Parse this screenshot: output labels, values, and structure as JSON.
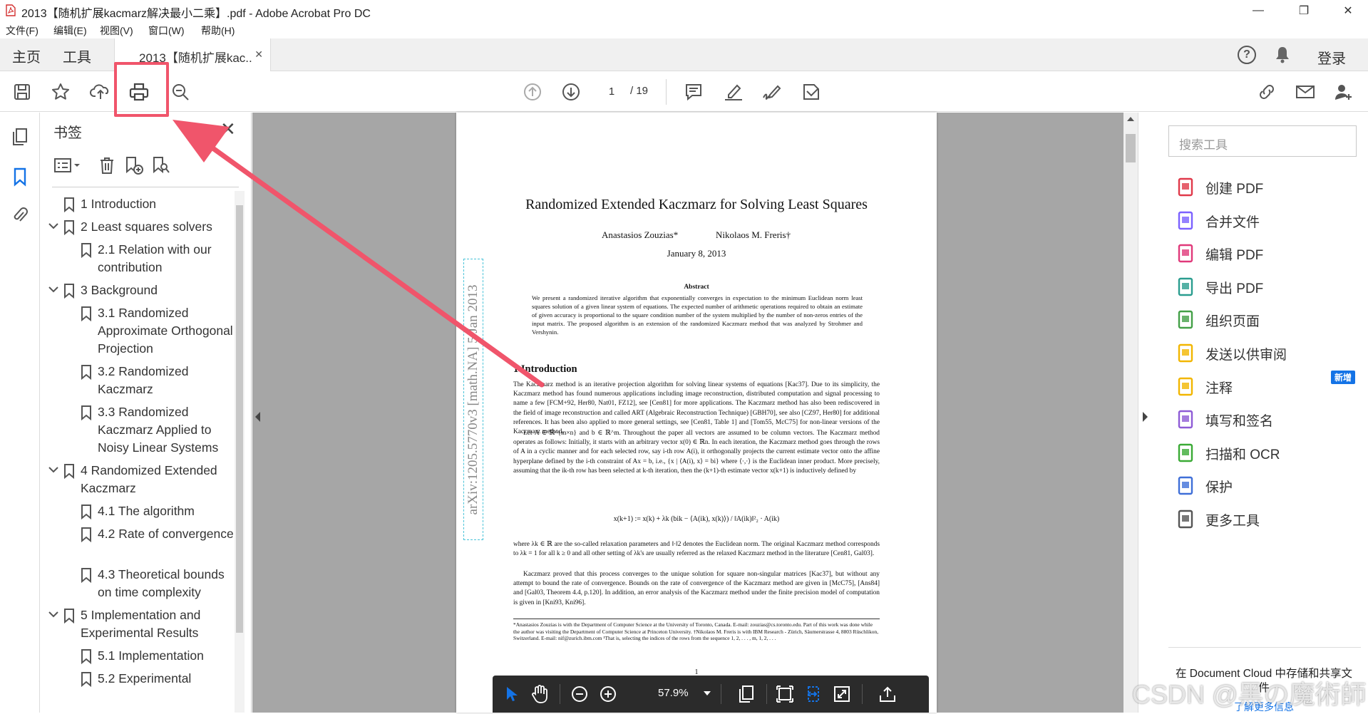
{
  "window": {
    "title": "2013【随机扩展kacmarz解决最小二乘】.pdf - Adobe Acrobat Pro DC",
    "minimize": "—",
    "maximize": "❐",
    "close": "✕"
  },
  "menu": [
    "文件(F)",
    "编辑(E)",
    "视图(V)",
    "窗口(W)",
    "帮助(H)"
  ],
  "tabs": {
    "home": "主页",
    "tools": "工具",
    "document": "2013【随机扩展kac...",
    "close": "✕",
    "help": "?",
    "login": "登录"
  },
  "toolbar": {
    "page_current": "1",
    "page_total": "/ 19",
    "icons": [
      "save-icon",
      "star-icon",
      "upload-icon",
      "print-icon",
      "zoom-search-icon",
      "page-up-icon",
      "page-down-icon",
      "comment-icon",
      "highlight-icon",
      "sign-icon",
      "stamp-icon",
      "share-link-icon",
      "email-icon",
      "add-user-icon"
    ]
  },
  "bookmarks": {
    "title": "书签",
    "close": "✕",
    "items": [
      {
        "label": "1 Introduction",
        "level": 0,
        "expandable": false
      },
      {
        "label": "2 Least squares solvers",
        "level": 0,
        "expandable": true
      },
      {
        "label": "2.1 Relation with our contribution",
        "level": 1,
        "expandable": false
      },
      {
        "label": "3 Background",
        "level": 0,
        "expandable": true
      },
      {
        "label": "3.1 Randomized Approximate Orthogonal Projection",
        "level": 1,
        "expandable": false
      },
      {
        "label": "3.2 Randomized Kaczmarz",
        "level": 1,
        "expandable": false
      },
      {
        "label": "3.3 Randomized Kaczmarz Applied to Noisy Linear Systems",
        "level": 1,
        "expandable": false
      },
      {
        "label": "4 Randomized Extended Kaczmarz",
        "level": 0,
        "expandable": true
      },
      {
        "label": "4.1 The algorithm",
        "level": 1,
        "expandable": false
      },
      {
        "label": "4.2 Rate of convergence",
        "level": 1,
        "expandable": false
      },
      {
        "label": "4.3 Theoretical bounds on time complexity",
        "level": 1,
        "expandable": false
      },
      {
        "label": "5 Implementation and Experimental Results",
        "level": 0,
        "expandable": true
      },
      {
        "label": "5.1 Implementation",
        "level": 1,
        "expandable": false
      },
      {
        "label": "5.2 Experimental",
        "level": 1,
        "expandable": false
      }
    ]
  },
  "pdf": {
    "arxiv": "arXiv:1205.5770v3  [math.NA]  5 Jan 2013",
    "title": "Randomized Extended Kaczmarz for Solving Least Squares",
    "author1": "Anastasios Zouzias*",
    "author2": "Nikolaos M. Freris†",
    "date": "January 8, 2013",
    "abstract_head": "Abstract",
    "abstract": "We present a randomized iterative algorithm that exponentially converges in expectation to the minimum Euclidean norm least squares solution of a given linear system of equations. The expected number of arithmetic operations required to obtain an estimate of given accuracy is proportional to the square condition number of the system multiplied by the number of non-zeros entries of the input matrix. The proposed algorithm is an extension of the randomized Kaczmarz method that was analyzed by Strohmer and Vershynin.",
    "section": "1   Introduction",
    "para1": "The Kaczmarz method is an iterative projection algorithm for solving linear systems of equations [Kac37]. Due to its simplicity, the Kaczmarz method has found numerous applications including image reconstruction, distributed computation and signal processing to name a few [FCM+92, Her80, Nat01, FZ12], see [Cen81] for more applications. The Kaczmarz method has also been rediscovered in the field of image reconstruction and called ART (Algebraic Reconstruction Technique) [GBH70], see also [CZ97, Her80] for additional references. It has been also applied to more general settings, see [Cen81, Table 1] and [Tom55, McC75] for non-linear versions of the Kaczmarz method.",
    "para2": "Let A ∈ ℝ^{m×n} and b ∈ ℝ^m. Throughout the paper all vectors are assumed to be column vectors. The Kaczmarz method operates as follows: Initially, it starts with an arbitrary vector x(0) ∈ ℝn. In each iteration, the Kaczmarz method goes through the rows of A in a cyclic manner and for each selected row, say i-th row A(i), it orthogonally projects the current estimate vector onto the affine hyperplane defined by the i-th constraint of Ax = b, i.e., {x | ⟨A(i), x⟩ = bi} where ⟨·,·⟩ is the Euclidean inner product. More precisely, assuming that the ik-th row has been selected at k-th iteration, then the (k+1)-th estimate vector x(k+1) is inductively defined by",
    "formula": "x(k+1) := x(k) + λk (bik − ⟨A(ik), x(k)⟩) / ‖A(ik)‖²₂ · A(ik)",
    "para3": "where λk ∈ ℝ are the so-called relaxation parameters and ‖·‖2 denotes the Euclidean norm. The original Kaczmarz method corresponds to λk = 1 for all k ≥ 0 and all other setting of λk's are usually referred as the relaxed Kaczmarz method in the literature [Cen81, Gal03].",
    "para4": "Kaczmarz proved that this process converges to the unique solution for square non-singular matrices [Kac37], but without any attempt to bound the rate of convergence. Bounds on the rate of convergence of the Kaczmarz method are given in [McC75], [Ans84] and [Gal03, Theorem 4.4, p.120]. In addition, an error analysis of the Kaczmarz method under the finite precision model of computation is given in [Kni93, Kni96].",
    "footnote": "*Anastasios Zouzias is with the Department of Computer Science at the University of Toronto, Canada. E-mail: zouzias@cs.toronto.edu. Part of this work was done while the author was visiting the Department of Computer Science at Princeton University. †Nikolaos M. Freris is with IBM Research - Zürich, Säumerstrasse 4, 8803 Rüschlikon, Switzerland. E-mail: nif@zurich.ibm.com ¹That is, selecting the indices of the rows from the sequence 1, 2, . . . , m, 1, 2, . . .",
    "page_number": "1"
  },
  "floatbar": {
    "zoom": "57.9%"
  },
  "rightpane": {
    "search_placeholder": "搜索工具",
    "tools": [
      {
        "label": "创建 PDF",
        "icon": "create-pdf-icon",
        "color": "#e0394a"
      },
      {
        "label": "合并文件",
        "icon": "combine-files-icon",
        "color": "#7b61ff"
      },
      {
        "label": "编辑 PDF",
        "icon": "edit-pdf-icon",
        "color": "#e0397a"
      },
      {
        "label": "导出 PDF",
        "icon": "export-pdf-icon",
        "color": "#2a9d8f"
      },
      {
        "label": "组织页面",
        "icon": "organize-pages-icon",
        "color": "#43a047"
      },
      {
        "label": "发送以供审阅",
        "icon": "send-review-icon",
        "color": "#f2b600"
      },
      {
        "label": "注释",
        "icon": "comment-tool-icon",
        "color": "#f2b600"
      },
      {
        "label": "填写和签名",
        "icon": "fill-sign-icon",
        "color": "#8e5bd6"
      },
      {
        "label": "扫描和 OCR",
        "icon": "scan-ocr-icon",
        "color": "#3aaa35"
      },
      {
        "label": "保护",
        "icon": "protect-icon",
        "color": "#3f6fd8"
      },
      {
        "label": "更多工具",
        "icon": "more-tools-icon",
        "color": "#555555"
      }
    ],
    "new_badge": "新增",
    "cloud_text": "在 Document Cloud 中存储和共享文件",
    "learn_more": "了解更多信息"
  },
  "watermark": "CSDN @黑の魔術師",
  "colors": {
    "accent": "#1473e6",
    "annotation": "#f0556b",
    "viewer_bg": "#a6a6a6",
    "cite_box": "#2fc33b"
  }
}
